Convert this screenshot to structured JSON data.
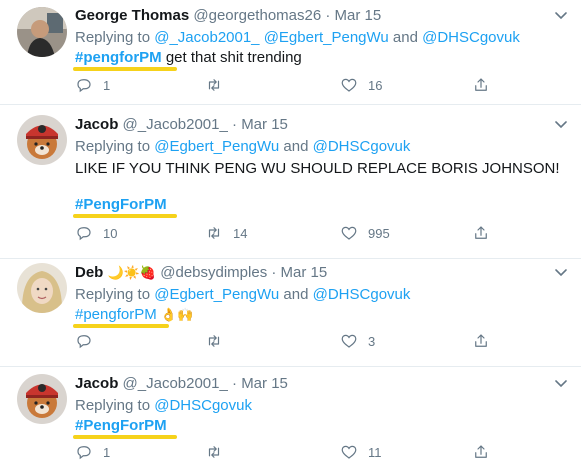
{
  "tweets": [
    {
      "name": "George Thomas",
      "handle": "@georgethomas26",
      "dot": "·",
      "date": "Mar 15",
      "replying_label": "Replying to",
      "mentions": [
        "@_Jacob2001_",
        "@Egbert_PengWu",
        "@DHSCgovuk"
      ],
      "and_label": "and",
      "hashtag": "#pengforPM",
      "body": "get that shit trending",
      "extra_line": "",
      "reply_count": "1",
      "retweet_count": "",
      "like_count": "16"
    },
    {
      "name": "Jacob",
      "handle": "@_Jacob2001_",
      "dot": "·",
      "date": "Mar 15",
      "replying_label": "Replying to",
      "mentions": [
        "@Egbert_PengWu",
        "@DHSCgovuk"
      ],
      "and_label": "and",
      "body": "LIKE IF YOU THINK PENG WU SHOULD REPLACE BORIS JOHNSON!",
      "hashtag": "#PengForPM",
      "reply_count": "10",
      "retweet_count": "14",
      "like_count": "995"
    },
    {
      "name": "Deb",
      "name_emoji": "🌙☀️🍓",
      "handle": "@debsydimples",
      "dot": "·",
      "date": "Mar 15",
      "replying_label": "Replying to",
      "mentions": [
        "@Egbert_PengWu",
        "@DHSCgovuk"
      ],
      "and_label": "and",
      "hashtag": "#pengforPM",
      "body_emoji": "👌🙌",
      "reply_count": "",
      "retweet_count": "",
      "like_count": "3"
    },
    {
      "name": "Jacob",
      "handle": "@_Jacob2001_",
      "dot": "·",
      "date": "Mar 15",
      "replying_label": "Replying to",
      "mentions": [
        "@DHSCgovuk"
      ],
      "hashtag": "#PengForPM",
      "reply_count": "1",
      "retweet_count": "",
      "like_count": "11"
    }
  ],
  "colors": {
    "link": "#1da1f2",
    "muted": "#657786",
    "highlight": "#f6d21a"
  },
  "icons": [
    "reply-icon",
    "retweet-icon",
    "like-icon",
    "share-icon",
    "caret-down-icon"
  ]
}
